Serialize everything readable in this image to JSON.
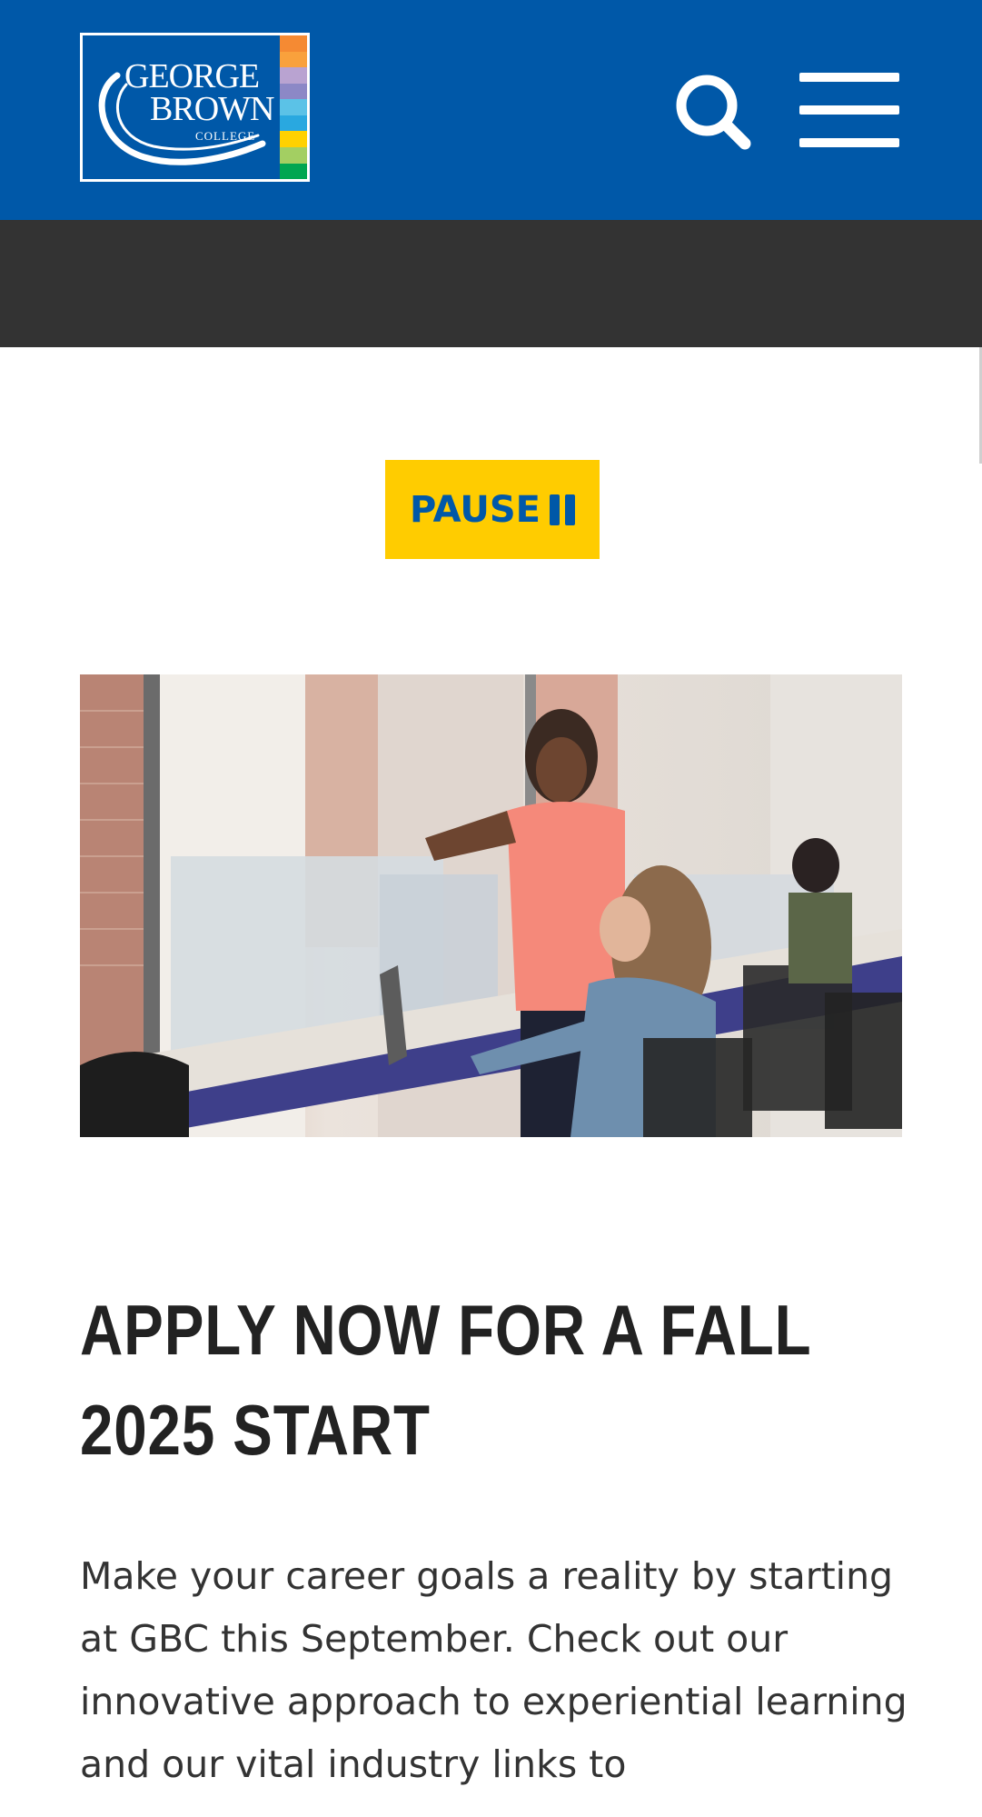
{
  "header": {
    "logo": {
      "line1": "GEORGE",
      "line2": "BROWN",
      "line3": "COLLEGE",
      "stripe_colors": [
        "#f58a33",
        "#f9a13c",
        "#b9a3d1",
        "#8c88c6",
        "#5bc2e7",
        "#29a8e0",
        "#ffd100",
        "#a3cf62",
        "#00a651"
      ]
    },
    "search_icon": "search-icon",
    "menu_icon": "hamburger-menu-icon",
    "background_color": "#0058a8"
  },
  "carousel": {
    "pause_label": "PAUSE",
    "pause_icon": "pause-icon",
    "button_color": "#ffcc00"
  },
  "hero": {
    "image_description_icon": "photo"
  },
  "content": {
    "headline": "APPLY NOW FOR A FALL 2025 START",
    "body": "Make your career goals a reality by starting at GBC this September. Check out our innovative approach to experiential learning and our vital industry links to"
  }
}
